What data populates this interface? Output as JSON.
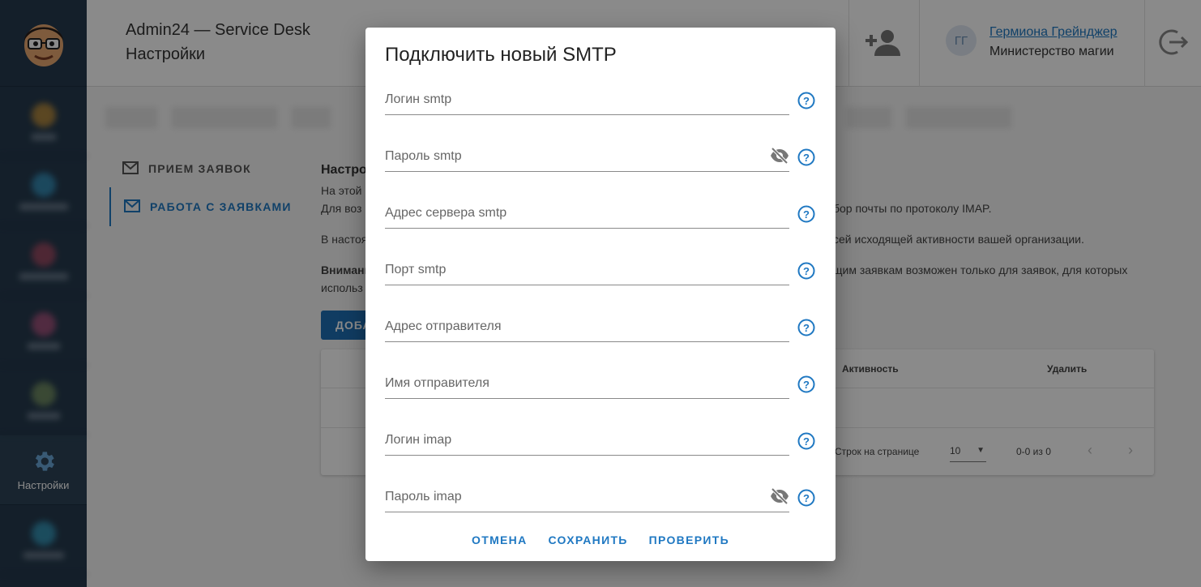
{
  "header": {
    "app_title": "Admin24 — Service Desk",
    "page_title": "Настройки",
    "user": {
      "initials": "ГГ",
      "name": "Гермиона Грейнджер",
      "org": "Министерство магии"
    }
  },
  "sidebar": {
    "active_label": "Настройки"
  },
  "left_menu": [
    {
      "label": "ПРИЕМ ЗАЯВОК"
    },
    {
      "label": "РАБОТА С ЗАЯВКАМИ"
    }
  ],
  "content": {
    "heading": "Настро",
    "line1": "На этой",
    "line2": "Для воз",
    "line2_right": "бор почты по протоколу IMAP.",
    "line3": "В настоя",
    "line3_right": "сей исходящей активности вашей организации.",
    "line4": "Внимани",
    "line4_right": "щим заявкам возможен только для заявок, для которых",
    "line5": "использ",
    "add_button": "ДОБА"
  },
  "table": {
    "col_activity": "Активность",
    "col_delete": "Удалить",
    "rows_per_page_label": "Строк на странице",
    "rows_per_page_value": "10",
    "range": "0-0 из 0"
  },
  "dialog": {
    "title": "Подключить новый SMTP",
    "fields": [
      {
        "placeholder": "Логин smtp"
      },
      {
        "placeholder": "Пароль smtp"
      },
      {
        "placeholder": "Адрес сервера smtp"
      },
      {
        "placeholder": "Порт smtp"
      },
      {
        "placeholder": "Адрес отправителя"
      },
      {
        "placeholder": "Имя отправителя"
      },
      {
        "placeholder": "Логин imap"
      },
      {
        "placeholder": "Пароль imap"
      }
    ],
    "cancel": "ОТМЕНА",
    "save": "СОХРАНИТЬ",
    "check": "ПРОВЕРИТЬ"
  },
  "colors": {
    "accent": "#1f78c2",
    "sidebar": "#253a4e"
  }
}
